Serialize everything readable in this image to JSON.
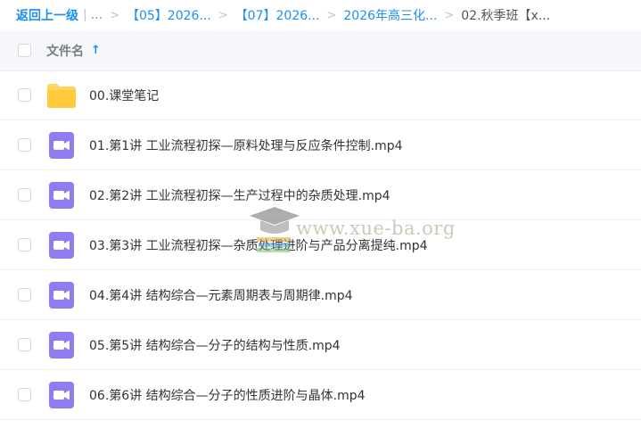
{
  "breadcrumb": {
    "back": "返回上一级",
    "dots": "...",
    "crumb1": "【05】2026...",
    "crumb2": "【07】2026...",
    "crumb3": "2026年高三化...",
    "current": "02.秋季班【x..."
  },
  "header": {
    "column_label": "文件名"
  },
  "files": [
    {
      "name": "00.课堂笔记",
      "type": "folder"
    },
    {
      "name": "01.第1讲 工业流程初探—原料处理与反应条件控制.mp4",
      "type": "video"
    },
    {
      "name": "02.第2讲 工业流程初探—生产过程中的杂质处理.mp4",
      "type": "video"
    },
    {
      "name": "03.第3讲 工业流程初探—杂质处理进阶与产品分离提纯.mp4",
      "type": "video"
    },
    {
      "name": "04.第4讲 结构综合—元素周期表与周期律.mp4",
      "type": "video"
    },
    {
      "name": "05.第5讲 结构综合—分子的结构与性质.mp4",
      "type": "video"
    },
    {
      "name": "06.第6讲 结构综合—分子的性质进阶与晶体.mp4",
      "type": "video"
    }
  ],
  "watermark": {
    "text": "www.xue-ba.org"
  },
  "colors": {
    "accent": "#1a8ff2",
    "folder": "#ffd55c",
    "video": "#8e7cf0"
  }
}
